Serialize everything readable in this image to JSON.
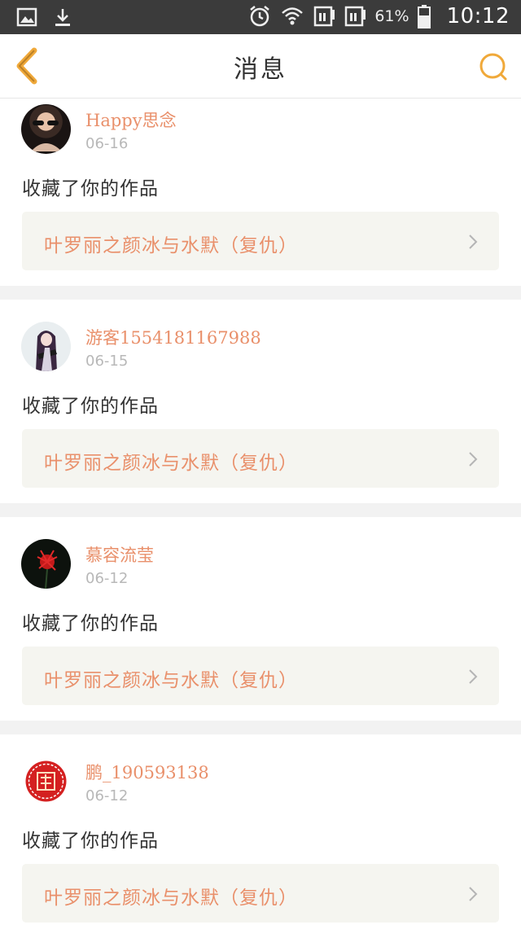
{
  "status_bar": {
    "battery": "61%",
    "time": "10:12",
    "icons": [
      "image-icon",
      "download-icon",
      "alarm-icon",
      "wifi-icon",
      "sim1-icon",
      "sim2-icon",
      "battery-icon"
    ]
  },
  "header": {
    "title": "消息",
    "back_icon": "back-chevron-icon",
    "search_icon": "search-icon",
    "accent": "#f0a93a"
  },
  "colors": {
    "name": "#e9906b",
    "work_title": "#e9906b",
    "date": "#b8b8b8",
    "divider": "#f2f2f2",
    "work_box_bg": "#f5f5f0"
  },
  "messages": [
    {
      "username": "Happy思念",
      "date": "06-16",
      "action": "收藏了你的作品",
      "work": "叶罗丽之颜冰与水默（复仇）",
      "avatar": "avatar-photo-sunglasses"
    },
    {
      "username": "游客1554181167988",
      "date": "06-15",
      "action": "收藏了你的作品",
      "work": "叶罗丽之颜冰与水默（复仇）",
      "avatar": "avatar-anime-girl"
    },
    {
      "username": "慕容流莹",
      "date": "06-12",
      "action": "收藏了你的作品",
      "work": "叶罗丽之颜冰与水默（复仇）",
      "avatar": "avatar-red-flower"
    },
    {
      "username": "鹏_190593138",
      "date": "06-12",
      "action": "收藏了你的作品",
      "work": "叶罗丽之颜冰与水默（复仇）",
      "avatar": "avatar-fu-seal"
    }
  ]
}
